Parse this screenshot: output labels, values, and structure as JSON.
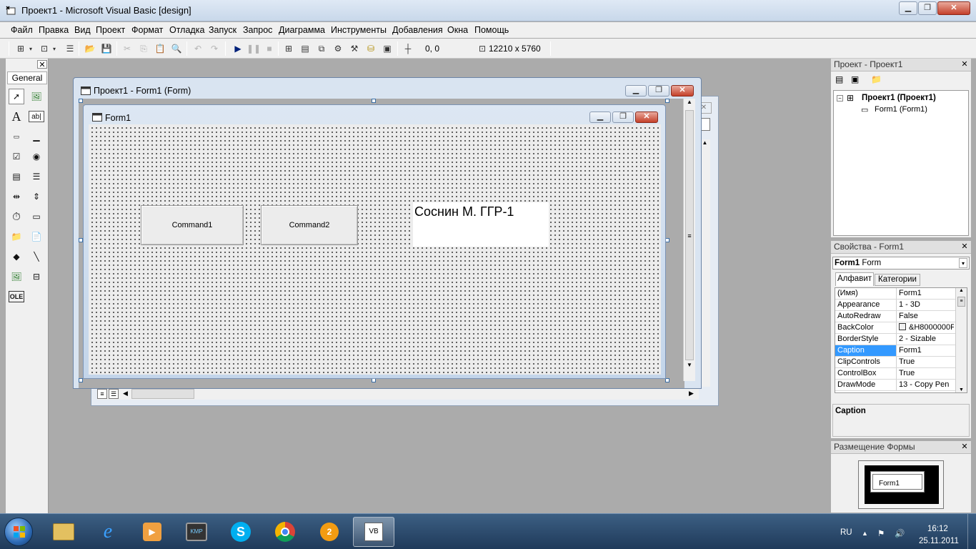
{
  "window": {
    "title": "Проект1 - Microsoft Visual Basic [design]"
  },
  "menu": [
    "Файл",
    "Правка",
    "Вид",
    "Проект",
    "Формат",
    "Отладка",
    "Запуск",
    "Запрос",
    "Диаграмма",
    "Инструменты",
    "Добавления",
    "Окна",
    "Помощь"
  ],
  "toolbar": {
    "position": "0, 0",
    "size": "12210 x 5760"
  },
  "toolbox": {
    "tab": "General"
  },
  "designer": {
    "title": "Проект1 - Form1 (Form)"
  },
  "form": {
    "caption": "Form1",
    "command1": "Command1",
    "command2": "Command2",
    "label1": "Соснин М. ГГР-1"
  },
  "project_panel": {
    "title": "Проект - Проект1",
    "root": "Проект1 (Проект1)",
    "child": "Form1 (Form1)"
  },
  "properties_panel": {
    "title": "Свойства - Form1",
    "object_name": "Form1",
    "object_type": "Form",
    "tab_alpha": "Алфавит",
    "tab_cat": "Категории",
    "rows": [
      {
        "name": "(Имя)",
        "value": "Form1"
      },
      {
        "name": "Appearance",
        "value": "1 - 3D"
      },
      {
        "name": "AutoRedraw",
        "value": "False"
      },
      {
        "name": "BackColor",
        "value": "&H8000000F"
      },
      {
        "name": "BorderStyle",
        "value": "2 - Sizable"
      },
      {
        "name": "Caption",
        "value": "Form1"
      },
      {
        "name": "ClipControls",
        "value": "True"
      },
      {
        "name": "ControlBox",
        "value": "True"
      },
      {
        "name": "DrawMode",
        "value": "13 - Copy Pen"
      }
    ],
    "selected": "Caption",
    "description_title": "Caption"
  },
  "layout_panel": {
    "title": "Размещение Формы",
    "preview_label": "Form1"
  },
  "taskbar": {
    "lang": "RU",
    "time": "16:12",
    "date": "25.11.2011"
  }
}
